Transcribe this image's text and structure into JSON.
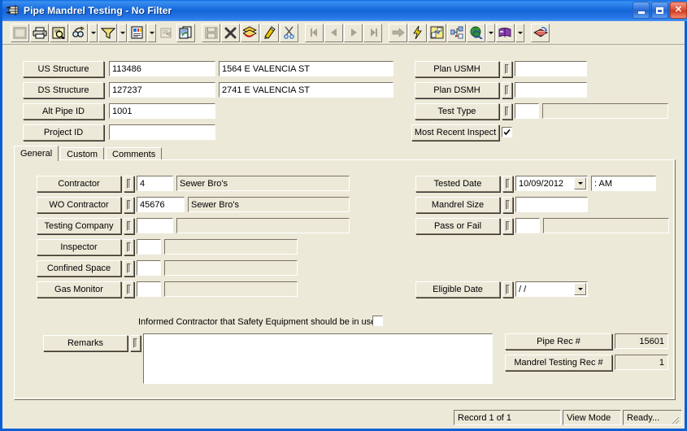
{
  "window": {
    "title": "Pipe Mandrel Testing - No Filter",
    "icon": "form-window-icon",
    "buttons": {
      "minimize": "Minimize",
      "maximize": "Maximize",
      "close": "Close"
    },
    "accent_color": "#1565d8",
    "face_color": "#ece9d8"
  },
  "toolbar": {
    "items": [
      {
        "name": "design-view-icon",
        "tip": "Design View"
      },
      {
        "name": "print-icon",
        "tip": "Print"
      },
      {
        "name": "print-preview-icon",
        "tip": "Print Preview"
      },
      {
        "name": "find-icon",
        "tip": "Find"
      },
      {
        "name": "find-dropdown-arrow",
        "tip": "Find Options"
      },
      {
        "name": "filter-icon",
        "tip": "Filter"
      },
      {
        "name": "filter-dropdown-arrow",
        "tip": "Filter Options"
      },
      {
        "name": "report-icon",
        "tip": "Report"
      },
      {
        "name": "report-dropdown-arrow",
        "tip": "Report Options"
      },
      {
        "name": "properties-icon",
        "tip": "Properties"
      },
      {
        "name": "copy-record-icon",
        "tip": "Copy Record"
      },
      {
        "name": "save-icon",
        "tip": "Save"
      },
      {
        "name": "delete-icon",
        "tip": "Delete"
      },
      {
        "name": "layers-icon",
        "tip": "Layers"
      },
      {
        "name": "edit-pencil-icon",
        "tip": "Edit"
      },
      {
        "name": "cut-scissors-icon",
        "tip": "Cut"
      },
      {
        "name": "first-record-icon",
        "tip": "First Record"
      },
      {
        "name": "previous-record-icon",
        "tip": "Previous Record"
      },
      {
        "name": "next-record-icon",
        "tip": "Next Record"
      },
      {
        "name": "last-record-icon",
        "tip": "Last Record"
      },
      {
        "name": "goto-record-icon",
        "tip": "Go To Record"
      },
      {
        "name": "lightning-icon",
        "tip": "Run"
      },
      {
        "name": "map-view-icon",
        "tip": "Map View"
      },
      {
        "name": "hierarchy-icon",
        "tip": "Hierarchy"
      },
      {
        "name": "globe-search-icon",
        "tip": "Web Search"
      },
      {
        "name": "globe-dropdown-arrow",
        "tip": "Web Options"
      },
      {
        "name": "book-icon",
        "tip": "Help Book"
      },
      {
        "name": "book-dropdown-arrow",
        "tip": "Help Options"
      },
      {
        "name": "export-icon",
        "tip": "Export"
      }
    ]
  },
  "header": {
    "left_fields": [
      {
        "label": "US Structure",
        "id_value": "113486",
        "desc_value": "1564  E  VALENCIA ST"
      },
      {
        "label": "DS Structure",
        "id_value": "127237",
        "desc_value": "2741  E VALENCIA ST"
      },
      {
        "label": "Alt Pipe ID",
        "id_value": "1001",
        "desc_value": ""
      },
      {
        "label": "Project ID",
        "id_value": "",
        "desc_value": ""
      }
    ],
    "right_fields": [
      {
        "label": "Plan USMH",
        "id_value": "",
        "desc_value": ""
      },
      {
        "label": "Plan DSMH",
        "id_value": "",
        "desc_value": ""
      },
      {
        "label": "Test Type",
        "id_value": "",
        "desc_value": ""
      }
    ],
    "most_recent_inspect": {
      "label": "Most Recent Inspect",
      "checked": true
    }
  },
  "tabs": [
    {
      "label": "General",
      "active": true
    },
    {
      "label": "Custom",
      "active": false
    },
    {
      "label": "Comments",
      "active": false
    }
  ],
  "general": {
    "left_fields": [
      {
        "label": "Contractor",
        "code": "4",
        "desc": "Sewer Bro's"
      },
      {
        "label": "WO Contractor",
        "code": "45676",
        "desc": "Sewer Bro's"
      },
      {
        "label": "Testing Company",
        "code": "",
        "desc": ""
      },
      {
        "label": "Inspector",
        "code": "",
        "desc": ""
      },
      {
        "label": "Confined Space",
        "code": "",
        "desc": ""
      },
      {
        "label": "Gas Monitor",
        "code": "",
        "desc": ""
      }
    ],
    "tested_date": {
      "label": "Tested Date",
      "value": "10/09/2012",
      "time_value": "  :     AM"
    },
    "mandrel_size": {
      "label": "Mandrel Size",
      "value": ""
    },
    "pass_or_fail": {
      "label": "Pass or Fail",
      "code": "",
      "desc": ""
    },
    "eligible_date": {
      "label": "Eligible Date",
      "value": "  /  /"
    },
    "safety_checkbox": {
      "label": "Informed Contractor that Safety Equipment should be in use",
      "checked": false
    },
    "remarks": {
      "label": "Remarks",
      "value": ""
    },
    "pipe_rec": {
      "label": "Pipe Rec #",
      "value": "15601"
    },
    "mandrel_rec": {
      "label": "Mandrel Testing Rec #",
      "value": "1"
    }
  },
  "statusbar": {
    "record": "Record 1 of 1",
    "mode": "View Mode",
    "state": "Ready...",
    "grip": "resize-grip-icon"
  }
}
